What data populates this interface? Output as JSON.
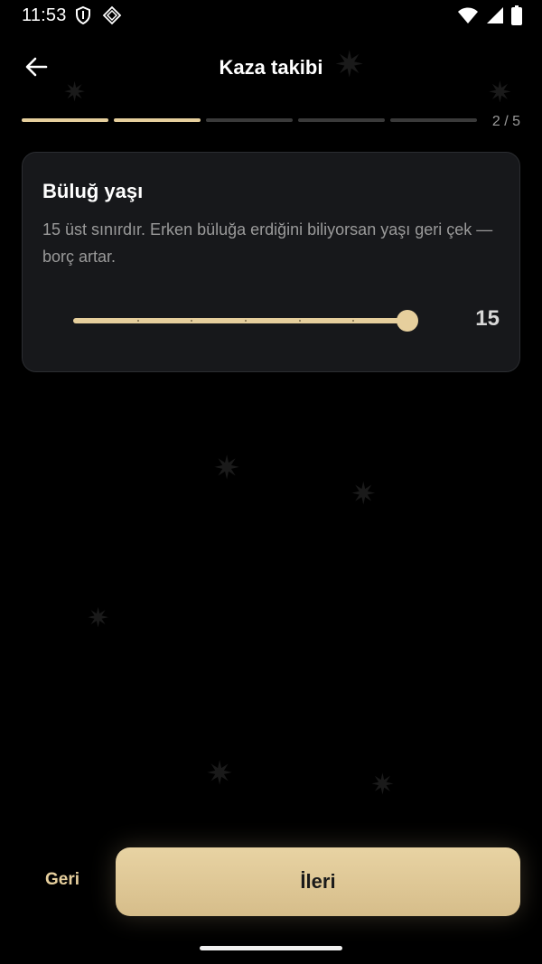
{
  "status_bar": {
    "time": "11:53",
    "icons_left": [
      "shield-icon",
      "app-notification-icon"
    ],
    "icons_right": [
      "wifi-icon",
      "signal-icon",
      "battery-icon"
    ]
  },
  "header": {
    "back_icon": "arrow-left-icon",
    "title": "Kaza takibi"
  },
  "progress": {
    "current_step": 2,
    "total_steps": 5,
    "label": "2 / 5"
  },
  "card": {
    "title": "Büluğ yaşı",
    "description": "15 üst sınırdır. Erken büluğa erdiğini biliyorsan yaşı geri çek — borç artar.",
    "slider": {
      "value_label": "15",
      "level": 1.0,
      "steps": 6
    }
  },
  "footer": {
    "back_label": "Geri",
    "next_label": "İleri"
  },
  "colors": {
    "background": "#000000",
    "accent": "#e6cf9d",
    "card": "#17181b",
    "muted_text": "#9a9a9a"
  }
}
